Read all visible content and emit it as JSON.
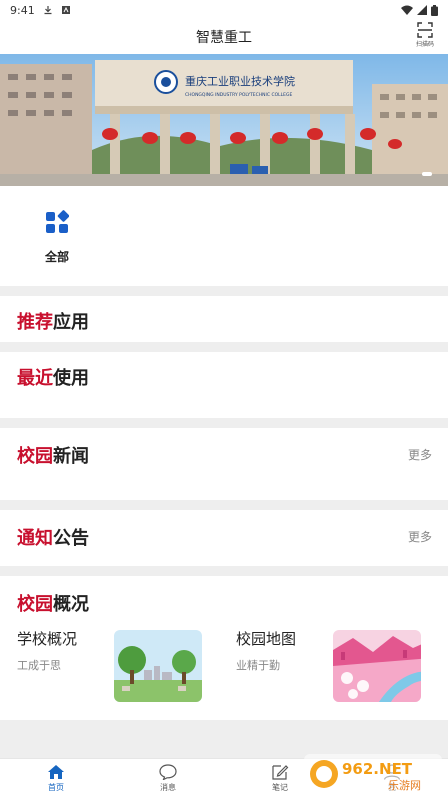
{
  "status": {
    "time": "9:41"
  },
  "header": {
    "title": "智慧重工",
    "scan_label": "扫描码"
  },
  "banner": {
    "school_name_cn": "重庆工业职业技术学院",
    "school_name_en": "CHONGQING INDUSTRY POLYTECHNIC COLLEGE"
  },
  "quick": {
    "all_label": "全部"
  },
  "sections": {
    "recommended": {
      "hl": "推荐",
      "rest": "应用"
    },
    "recent": {
      "hl": "最近",
      "rest": "使用"
    },
    "news": {
      "hl": "校园",
      "rest": "新闻",
      "more": "更多"
    },
    "notice": {
      "hl": "通知",
      "rest": "公告",
      "more": "更多"
    },
    "overview": {
      "hl": "校园",
      "rest": "概况",
      "items": [
        {
          "title": "学校概况",
          "subtitle": "工成于思"
        },
        {
          "title": "校园地图",
          "subtitle": "业精于勤"
        }
      ]
    }
  },
  "tabs": [
    {
      "label": "首页",
      "icon": "home-icon"
    },
    {
      "label": "消息",
      "icon": "message-icon"
    },
    {
      "label": "笔记",
      "icon": "note-icon"
    },
    {
      "label": "我",
      "icon": "user-icon"
    }
  ],
  "watermark": {
    "text": "962.NET",
    "sub": "乐游网"
  },
  "colors": {
    "accent": "#c8102e",
    "primary": "#1565c0"
  }
}
